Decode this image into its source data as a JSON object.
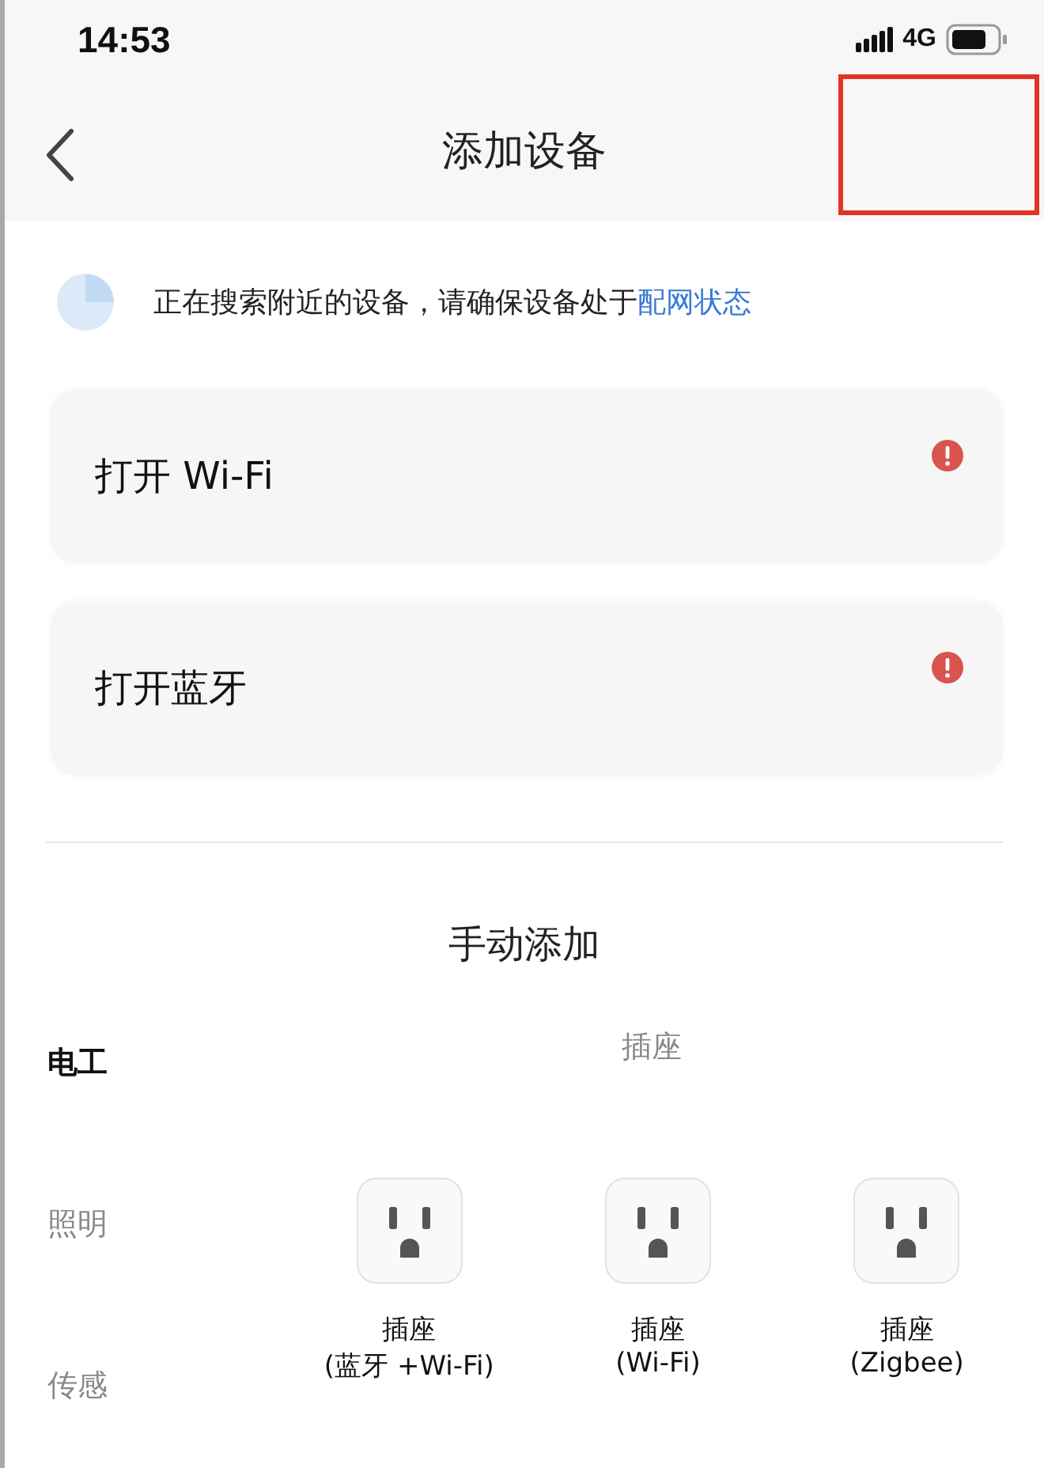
{
  "status_bar": {
    "time": "14:53",
    "network": "4G"
  },
  "nav": {
    "title": "添加设备"
  },
  "search": {
    "text": "正在搜索附近的设备，请确保设备处于",
    "link": "配网状态"
  },
  "prompts": [
    {
      "label": "打开 Wi-Fi",
      "alert": true
    },
    {
      "label": "打开蓝牙",
      "alert": true
    }
  ],
  "manual": {
    "title": "手动添加",
    "categories": [
      {
        "label": "电工",
        "selected": true
      },
      {
        "label": "照明",
        "selected": false
      },
      {
        "label": "传感",
        "selected": false
      }
    ],
    "group_title": "插座",
    "products": [
      {
        "name": "插座",
        "protocol": "(蓝牙 +Wi-Fi)"
      },
      {
        "name": "插座",
        "protocol": "(Wi-Fi)"
      },
      {
        "name": "插座",
        "protocol": "(Zigbee)"
      }
    ]
  }
}
